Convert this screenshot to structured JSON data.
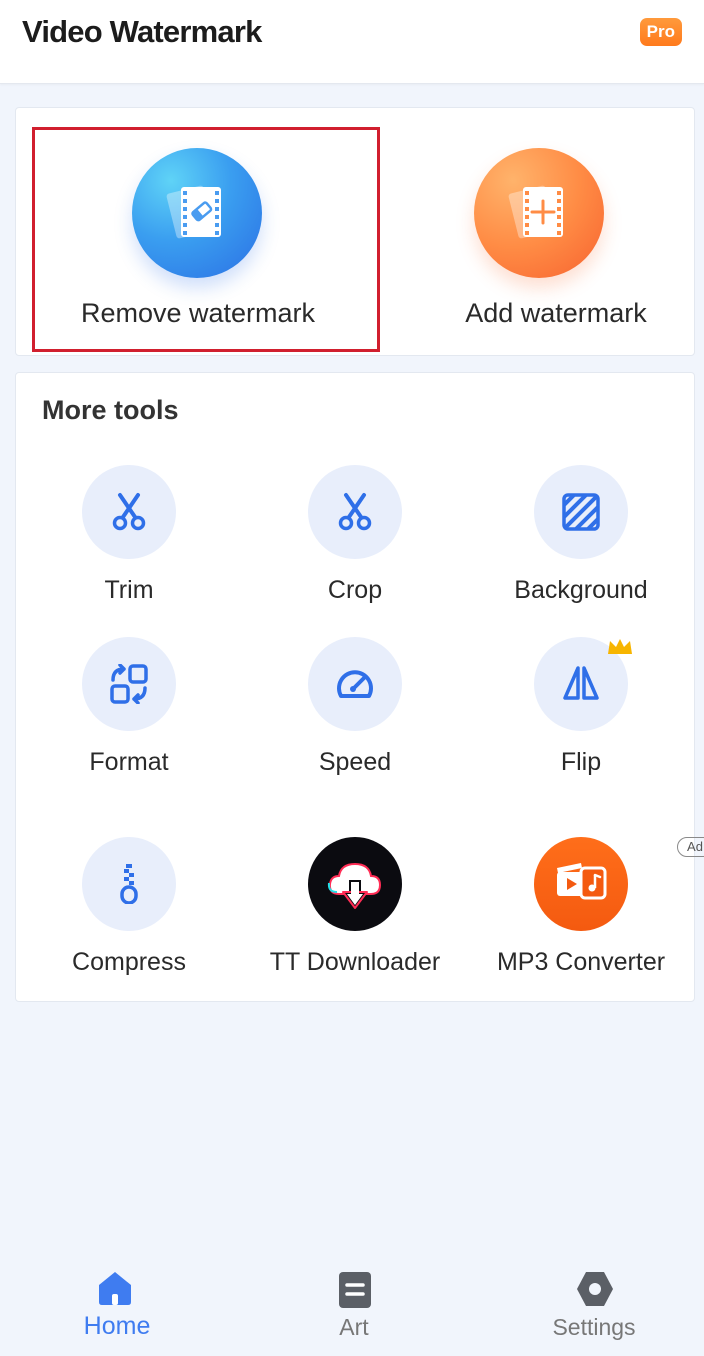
{
  "header": {
    "title": "Video Watermark",
    "pro_badge": "Pro"
  },
  "main_actions": [
    {
      "label": "Remove watermark",
      "icon": "film-eraser-icon",
      "color": "#3a9ef0",
      "highlighted": true
    },
    {
      "label": "Add watermark",
      "icon": "film-plus-icon",
      "color": "#ff8c45",
      "highlighted": false
    }
  ],
  "more_tools": {
    "title": "More tools",
    "items": [
      {
        "label": "Trim",
        "icon": "scissors-icon"
      },
      {
        "label": "Crop",
        "icon": "scissors-icon"
      },
      {
        "label": "Background",
        "icon": "striped-square-icon"
      },
      {
        "label": "Format",
        "icon": "format-convert-icon"
      },
      {
        "label": "Speed",
        "icon": "speedometer-icon"
      },
      {
        "label": "Flip",
        "icon": "flip-icon",
        "badge": "crown"
      },
      {
        "label": "Compress",
        "icon": "zipper-icon"
      },
      {
        "label": "TT Downloader",
        "icon": "cloud-download-icon"
      },
      {
        "label": "MP3 Converter",
        "icon": "video-music-icon",
        "badge": "Ad"
      }
    ]
  },
  "bottom_nav": [
    {
      "label": "Home",
      "icon": "home-icon",
      "active": true
    },
    {
      "label": "Art",
      "icon": "document-icon",
      "active": false
    },
    {
      "label": "Settings",
      "icon": "gear-icon",
      "active": false
    }
  ],
  "colors": {
    "accent": "#3f7cf0",
    "tool_icon": "#2f6fe8",
    "tool_circle": "#e8eefb",
    "highlight_border": "#d11f2e",
    "pro_badge": "#ff7a1c"
  }
}
